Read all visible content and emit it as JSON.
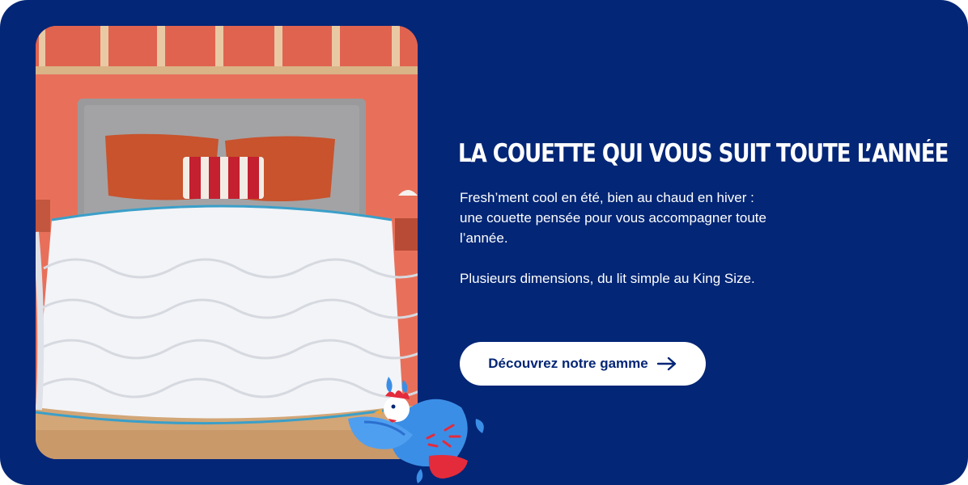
{
  "banner": {
    "title": "LA COUETTE QUI VOUS SUIT TOUTE L’ANNÉE",
    "description_lines": [
      "Fresh’ment cool en été, bien au chaud en hiver :",
      "une couette pensée pour vous accompagner toute",
      "l’année."
    ],
    "description_2": "Plusieurs dimensions, du lit simple au King Size.",
    "cta_label": "Découvrez notre gamme",
    "cta_icon": "arrow-right-icon",
    "photo_icon": "bed-photo",
    "mascot_icon": "rooster-mascot-icon"
  },
  "colors": {
    "background": "#032676",
    "button_bg": "#ffffff",
    "button_text": "#032676",
    "wall": "#e8705a",
    "headboard": "#9a9a9c",
    "duvet": "#f3f4f7",
    "piping": "#3a9fc9",
    "accent_red": "#e42b3c",
    "accent_blue": "#3b8ee6"
  }
}
